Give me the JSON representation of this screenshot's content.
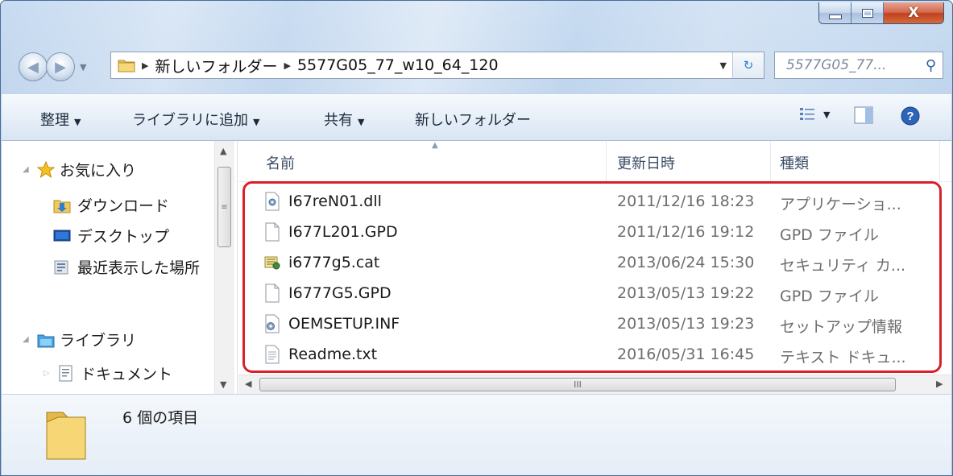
{
  "window": {
    "caption": {
      "minimize": "minimize",
      "maximize": "maximize",
      "close": "X"
    }
  },
  "address_bar": {
    "crumbs": [
      "新しいフォルダー",
      "5577G05_77_w10_64_120"
    ]
  },
  "search": {
    "placeholder": "5577G05_77..."
  },
  "toolbar": {
    "organize": "整理",
    "add_to_library": "ライブラリに追加",
    "share": "共有",
    "new_folder": "新しいフォルダー"
  },
  "sidebar": {
    "favorites": "お気に入り",
    "items": [
      {
        "label": "ダウンロード",
        "icon": "download-folder-icon"
      },
      {
        "label": "デスクトップ",
        "icon": "desktop-icon"
      },
      {
        "label": "最近表示した場所",
        "icon": "recent-places-icon"
      }
    ],
    "libraries": "ライブラリ",
    "library_items": [
      {
        "label": "ドキュメント",
        "icon": "documents-icon"
      }
    ]
  },
  "file_list": {
    "columns": [
      "名前",
      "更新日時",
      "種類"
    ],
    "rows": [
      {
        "name": "I67reN01.dll",
        "date": "2011/12/16 18:23",
        "type": "アプリケーショ...",
        "icon": "dll-icon"
      },
      {
        "name": "I677L201.GPD",
        "date": "2011/12/16 19:12",
        "type": "GPD ファイル",
        "icon": "blank-file-icon"
      },
      {
        "name": "i6777g5.cat",
        "date": "2013/06/24 15:30",
        "type": "セキュリティ カ...",
        "icon": "security-catalog-icon"
      },
      {
        "name": "I6777G5.GPD",
        "date": "2013/05/13 19:22",
        "type": "GPD ファイル",
        "icon": "blank-file-icon"
      },
      {
        "name": "OEMSETUP.INF",
        "date": "2013/05/13 19:23",
        "type": "セットアップ情報",
        "icon": "setup-info-icon"
      },
      {
        "name": "Readme.txt",
        "date": "2016/05/31 16:45",
        "type": "テキスト ドキュ...",
        "icon": "text-file-icon"
      }
    ],
    "hscroll_grip": "III"
  },
  "details": {
    "item_count": "6 個の項目"
  },
  "colors": {
    "highlight_box": "#d8202a",
    "window_frame": "#b6cde8"
  }
}
